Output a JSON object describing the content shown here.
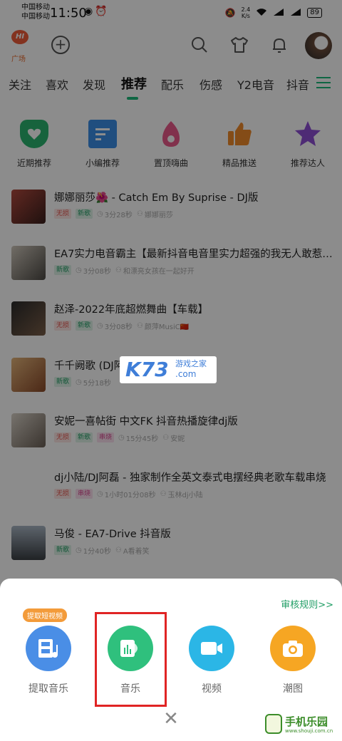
{
  "status": {
    "carrier1": "中国移动",
    "carrier2": "中国移动",
    "time": "11:50",
    "speed_value": "2.4",
    "speed_unit": "K/s",
    "battery": "89"
  },
  "header": {
    "logo_text": "HI",
    "logo_label": "广场"
  },
  "tabs": [
    "关注",
    "喜欢",
    "发现",
    "推荐",
    "配乐",
    "伤感",
    "Y2电音",
    "抖音"
  ],
  "active_tab": "推荐",
  "categories": [
    {
      "label": "近期推荐",
      "icon": "shield-heart-icon",
      "color": "#2bb56f"
    },
    {
      "label": "小编推荐",
      "icon": "document-icon",
      "color": "#3b8ee8"
    },
    {
      "label": "置顶嗨曲",
      "icon": "flame-icon",
      "color": "#ec5a8a"
    },
    {
      "label": "精品推送",
      "icon": "thumbs-up-icon",
      "color": "#f08a2b"
    },
    {
      "label": "推荐达人",
      "icon": "star-icon",
      "color": "#8e4fd6"
    }
  ],
  "songs": [
    {
      "title": "娜娜丽莎🌺 - Catch Em By Suprise - DJ版",
      "tags": [
        "无损",
        "新歌"
      ],
      "duration": "3分28秒",
      "artist": "娜娜丽莎"
    },
    {
      "title": "EA7实力电音霸主【最新抖音电音里实力超强的我无人敢惹…",
      "tags": [
        "新歌"
      ],
      "duration": "3分08秒",
      "artist": "和漂亮女孩在一起好开"
    },
    {
      "title": "赵泽-2022年底超燃舞曲【车载】",
      "tags": [
        "无损",
        "新歌"
      ],
      "duration": "3分08秒",
      "artist": "颜萍MusiC🇨🇳"
    },
    {
      "title": "千千阙歌 (DJ阿",
      "tags": [
        "新歌"
      ],
      "duration": "5分18秒",
      "artist": ""
    },
    {
      "title": "安妮一喜帖街 中文FK 抖音热播旋律dj版",
      "tags": [
        "无损",
        "新歌",
        "串烧"
      ],
      "duration": "15分45秒",
      "artist": "安妮"
    },
    {
      "title": "dj小陆/DJ阿磊 - 独家制作全英文泰式电摆经典老歌车载串烧",
      "tags": [
        "无损",
        "串烧"
      ],
      "duration": "1小时01分08秒",
      "artist": "玉林dj小陆"
    },
    {
      "title": "马俊 - EA7-Drive 抖音版",
      "tags": [
        "新歌"
      ],
      "duration": "1分40秒",
      "artist": "A看着笑"
    }
  ],
  "watermark": {
    "k73": "K73",
    "cn": "游戏之家",
    "com": ".com",
    "site_name": "手机乐园",
    "site_url": "www.shouji.com.cn"
  },
  "sheet": {
    "review_link": "审核规则>>",
    "badge": "提取短视频",
    "actions": [
      {
        "label": "提取音乐",
        "icon": "film-music-icon",
        "color": "#4a8ee6"
      },
      {
        "label": "音乐",
        "icon": "music-equalizer-icon",
        "color": "#2fc07d"
      },
      {
        "label": "视频",
        "icon": "video-camera-icon",
        "color": "#2bb6e6"
      },
      {
        "label": "潮图",
        "icon": "camera-icon",
        "color": "#f6a623"
      }
    ],
    "close_glyph": "✕"
  }
}
